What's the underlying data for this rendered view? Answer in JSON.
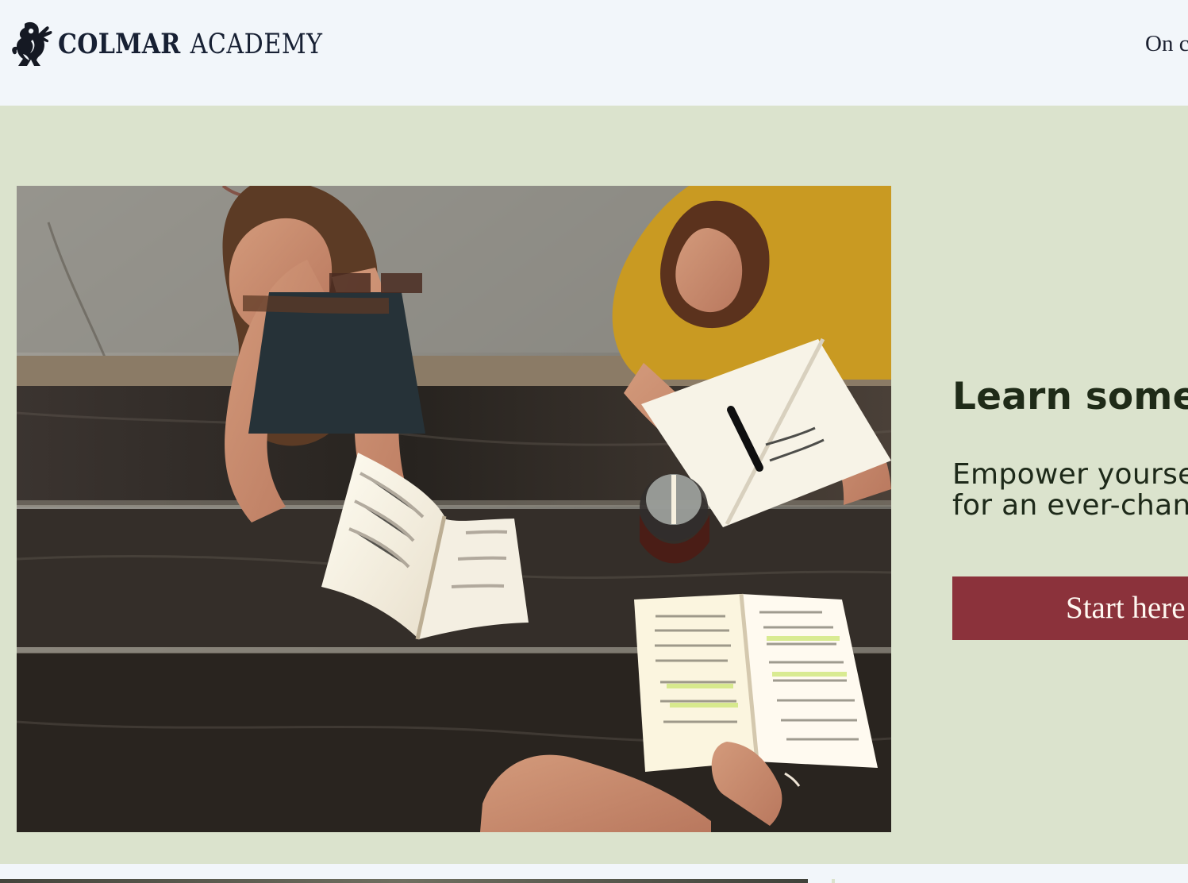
{
  "header": {
    "logo_icon": "griffin-crest-icon",
    "brand_primary": "COLMAR",
    "brand_secondary": "ACADEMY",
    "nav_items": [
      {
        "label": "On c"
      }
    ]
  },
  "hero": {
    "image_icon": "students-reading-photo",
    "title": "Learn somet",
    "subtitle_line_1": "Empower yourse",
    "subtitle_line_2": "for an ever-chang",
    "cta_label": "Start here"
  },
  "colors": {
    "header_background": "#f2f6fa",
    "hero_background": "#dbe3cd",
    "brand_text": "#172033",
    "hero_text": "#1f2b18",
    "cta_background": "#8b323b",
    "cta_text": "#fff8f1"
  }
}
